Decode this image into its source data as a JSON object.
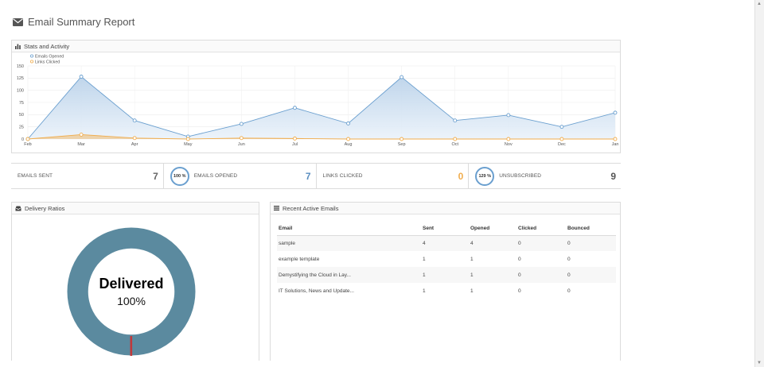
{
  "page": {
    "title": "Email Summary Report",
    "title_icon": "envelope-icon"
  },
  "stats_panel": {
    "title": "Stats and Activity",
    "icon": "bar-chart-icon"
  },
  "chart_data": {
    "type": "area",
    "categories": [
      "Feb",
      "Mar",
      "Apr",
      "May",
      "Jun",
      "Jul",
      "Aug",
      "Sep",
      "Oct",
      "Nov",
      "Dec",
      "Jan"
    ],
    "series": [
      {
        "name": "Emails Opened",
        "color": "#6a9fcf",
        "values": [
          0,
          128,
          38,
          5,
          31,
          64,
          32,
          127,
          38,
          49,
          25,
          54
        ]
      },
      {
        "name": "Links Clicked",
        "color": "#f0ad4e",
        "values": [
          0,
          9,
          2,
          0,
          2,
          1,
          0,
          0,
          0,
          0,
          0,
          0
        ]
      }
    ],
    "ylim": [
      0,
      150
    ],
    "yticks": [
      0,
      25,
      50,
      75,
      100,
      125,
      150
    ],
    "grid": true,
    "legend_position": "top-left",
    "title": "",
    "xlabel": "",
    "ylabel": ""
  },
  "metrics": {
    "emails_sent": {
      "label": "EMAILS SENT",
      "value": "7"
    },
    "emails_opened": {
      "label": "EMAILS OPENED",
      "value": "7",
      "ring": "100 %"
    },
    "links_clicked": {
      "label": "LINKS CLICKED",
      "value": "0"
    },
    "unsubscribed": {
      "label": "UNSUBSCRIBED",
      "value": "9",
      "ring": "129 %"
    }
  },
  "delivery_panel": {
    "title": "Delivery Ratios",
    "icon": "inbox-icon",
    "center_label": "Delivered",
    "center_value": "100%",
    "delivered_fraction": 1.0,
    "ring_color": "#5b8a9f",
    "marker_color": "#c0393b"
  },
  "recent_panel": {
    "title": "Recent Active Emails",
    "icon": "list-icon",
    "columns": [
      "Email",
      "Sent",
      "Opened",
      "Clicked",
      "Bounced"
    ],
    "rows": [
      [
        "sample",
        "4",
        "4",
        "0",
        "0"
      ],
      [
        "example template",
        "1",
        "1",
        "0",
        "0"
      ],
      [
        "Demystifying the Cloud in Lay...",
        "1",
        "1",
        "0",
        "0"
      ],
      [
        "IT Solutions, News and Update...",
        "1",
        "1",
        "0",
        "0"
      ]
    ]
  }
}
